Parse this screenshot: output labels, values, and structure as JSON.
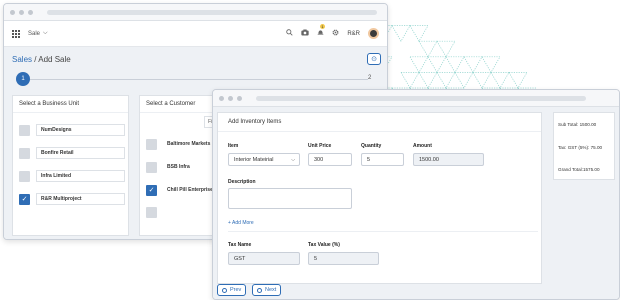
{
  "topbar": {
    "module": "Sale",
    "module_caret": "⌵",
    "notification_count": "1",
    "user_initials": "R&R",
    "icons": [
      "search-icon",
      "camera-icon",
      "bell-icon",
      "gear-icon"
    ]
  },
  "breadcrumb": {
    "parent": "Sales",
    "separator": " / ",
    "current": "Add Sale"
  },
  "help_icon": "⊙",
  "stepper": {
    "step1": "1",
    "step2": "2"
  },
  "business_unit": {
    "title": "Select a Business Unit",
    "items": [
      {
        "label": "NumDesigns",
        "checked": false
      },
      {
        "label": "Bonfire Retail",
        "checked": false
      },
      {
        "label": "Infra Limited",
        "checked": false
      },
      {
        "label": "R&R Multiproject",
        "checked": true
      }
    ]
  },
  "customer": {
    "title": "Select a Customer",
    "filter": "Filte",
    "items": [
      {
        "label": "Baltimore Markets",
        "checked": false
      },
      {
        "label": "BSB Infra",
        "checked": false
      },
      {
        "label": "Chill Pill Enterprises",
        "checked": true
      }
    ]
  },
  "inventory": {
    "title": "Add Inventory Items",
    "labels": {
      "item": "Item",
      "unit_price": "Unit Price",
      "quantity": "Quantity",
      "amount": "Amount",
      "description": "Description",
      "tax_name": "Tax Name",
      "tax_value": "Tax Value (%)"
    },
    "values": {
      "item": "Interior Mateirial",
      "unit_price": "300",
      "quantity": "5",
      "amount": "1500.00",
      "description": "",
      "tax_name": "GST",
      "tax_value": "5"
    },
    "add_more": "+ Add More"
  },
  "summary": {
    "sub_total": "Sub Total:    1500.00",
    "tax": "Tax: GST (5%): 75.00",
    "grand_total": "Grand Total:1575.00"
  },
  "nav": {
    "prev": "Prev",
    "next": "Next"
  },
  "colors": {
    "accent": "#2f6db5",
    "pattern": "#8fd3cd"
  }
}
